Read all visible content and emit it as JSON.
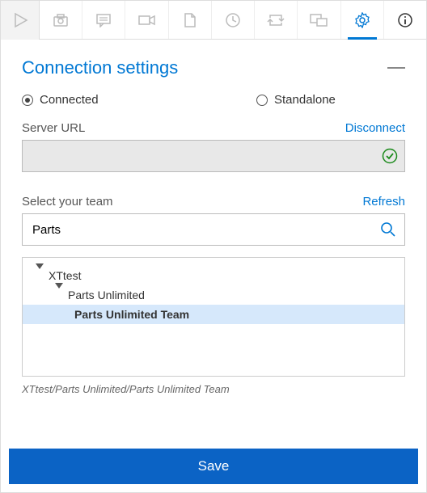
{
  "section": {
    "title": "Connection settings"
  },
  "mode": {
    "connected_label": "Connected",
    "standalone_label": "Standalone",
    "selected": "connected"
  },
  "server": {
    "label": "Server URL",
    "disconnect": "Disconnect",
    "value": "",
    "validated": true
  },
  "team": {
    "label": "Select your team",
    "refresh": "Refresh",
    "search_value": "Parts",
    "tree": {
      "root": "XTtest",
      "project": "Parts Unlimited",
      "team": "Parts Unlimited Team"
    },
    "path": "XTtest/Parts Unlimited/Parts Unlimited Team"
  },
  "actions": {
    "save": "Save"
  },
  "toolbar_icons": [
    "play",
    "camera",
    "comment",
    "video",
    "file",
    "clock",
    "repeat",
    "screens",
    "gear",
    "info"
  ],
  "active_tab": "gear"
}
